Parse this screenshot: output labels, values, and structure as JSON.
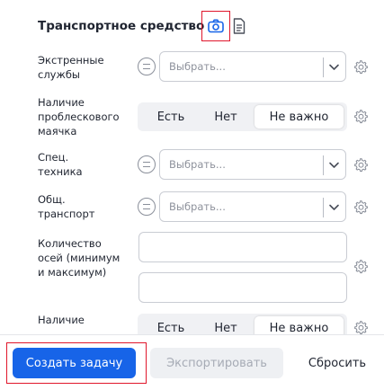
{
  "section": {
    "title": "Транспортное средство",
    "camera_icon": "camera-icon",
    "document_icon": "document-icon"
  },
  "rows": {
    "emergency": {
      "label": "Экстренные службы",
      "placeholder": "Выбрать..."
    },
    "beacon": {
      "label": "Наличие проблескового маячка",
      "options": [
        "Есть",
        "Нет",
        "Не важно"
      ],
      "selected": "Не важно"
    },
    "special": {
      "label": "Спец. техника",
      "placeholder": "Выбрать..."
    },
    "public": {
      "label": "Общ. транспорт",
      "placeholder": "Выбрать..."
    },
    "axles": {
      "label": "Количество осей (минимум и максимум)",
      "min_value": "",
      "max_value": ""
    },
    "partial": {
      "label": "Наличие",
      "options": [
        "Есть",
        "Нет",
        "Не важно"
      ],
      "selected": "Не важно"
    }
  },
  "footer": {
    "create": "Создать задачу",
    "export": "Экспортировать",
    "reset": "Сбросить"
  },
  "colors": {
    "accent": "#1764e8",
    "highlight": "#e0162b"
  }
}
